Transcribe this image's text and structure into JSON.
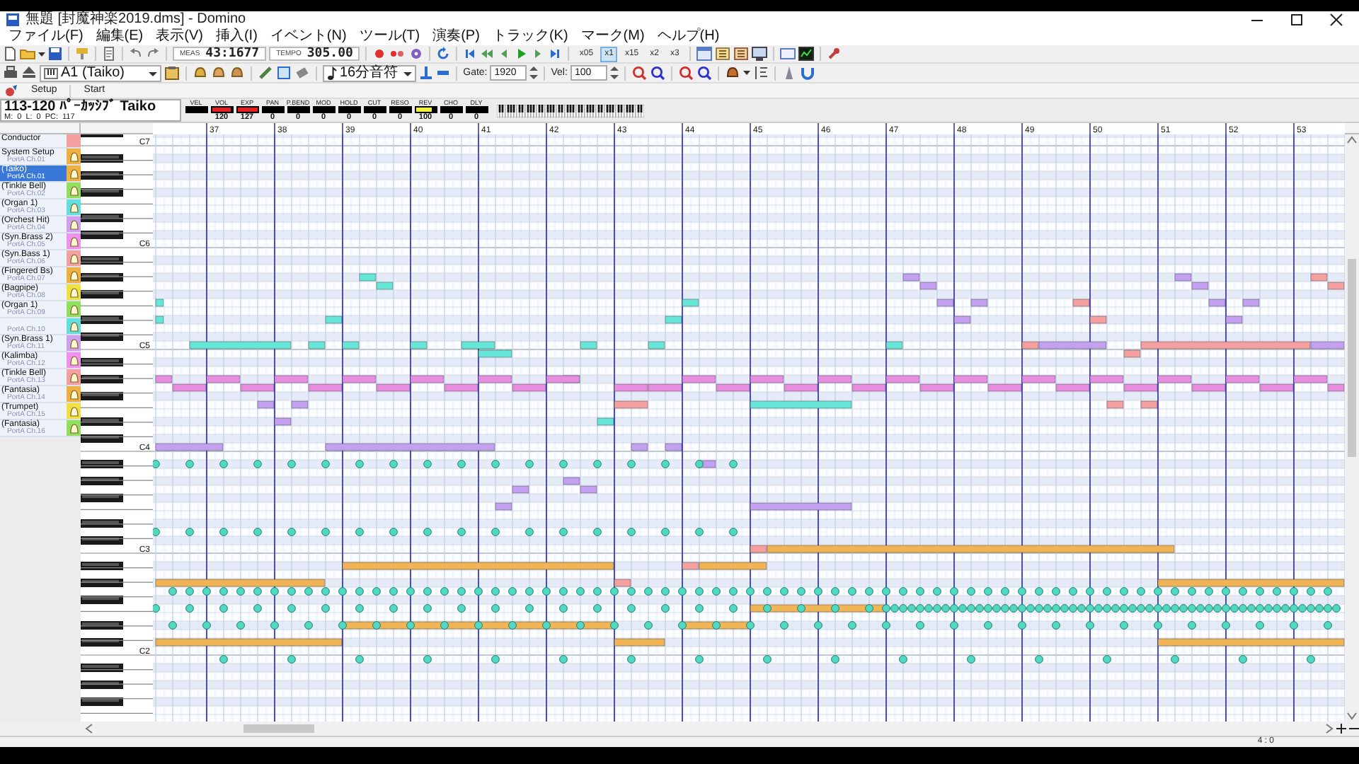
{
  "window": {
    "title": "無題 [封魔神楽2019.dms] - Domino"
  },
  "menu": [
    "ファイル(F)",
    "編集(E)",
    "表示(V)",
    "挿入(I)",
    "イベント(N)",
    "ツール(T)",
    "演奏(P)",
    "トラック(K)",
    "マーク(M)",
    "ヘルプ(H)"
  ],
  "toolbar": {
    "meas_label": "MEAS",
    "meas": "43:1677",
    "tempo_label": "TEMPO",
    "tempo": "305.00",
    "speeds": [
      {
        "label": "x05",
        "selected": false
      },
      {
        "label": "x1",
        "selected": true
      },
      {
        "label": "x15",
        "selected": false
      },
      {
        "label": "x2",
        "selected": false
      },
      {
        "label": "x3",
        "selected": false
      }
    ]
  },
  "toolbar2": {
    "instrument": "A1 (Taiko)",
    "note_length": "16分音符",
    "gate_label": "Gate:",
    "gate": "1920",
    "vel_label": "Vel:",
    "vel": "100"
  },
  "buttons": [
    "Setup",
    "Start"
  ],
  "info": {
    "program": "113-120 ﾊﾟｰｶｯｼﾌﾞ Taiko",
    "m_label": "M:",
    "m": "0",
    "l_label": "L:",
    "l": "0",
    "pc_label": "PC:",
    "pc": "117"
  },
  "mixer": [
    {
      "label": "VEL"
    },
    {
      "label": "VOL",
      "value": "120",
      "level": 0.94,
      "color": "#e02020"
    },
    {
      "label": "EXP",
      "value": "127",
      "level": 1,
      "color": "#e02020"
    },
    {
      "label": "PAN",
      "value": "0"
    },
    {
      "label": "P.BEND",
      "value": "0"
    },
    {
      "label": "MOD",
      "value": "0"
    },
    {
      "label": "HOLD",
      "value": "0"
    },
    {
      "label": "CUT",
      "value": "0"
    },
    {
      "label": "RESO",
      "value": "0"
    },
    {
      "label": "REV",
      "value": "100",
      "level": 0.79,
      "color": "#f0f040"
    },
    {
      "label": "CHO",
      "value": "0"
    },
    {
      "label": "DLY",
      "value": "0"
    }
  ],
  "tracks": [
    {
      "name": "Conductor",
      "color": "#f4a0a0",
      "selected": false
    },
    {
      "name": "System Setup",
      "port": "PortA  Ch.01",
      "color": "#f0b040",
      "selected": false
    },
    {
      "name": "(Taiko)",
      "port": "PortA  Ch.01",
      "color": "#f0b040",
      "selected": true
    },
    {
      "name": "(Tinkle Bell)",
      "port": "PortA  Ch.02",
      "color": "#90e060",
      "selected": false
    },
    {
      "name": "(Organ 1)",
      "port": "PortA  Ch.03",
      "color": "#60e0e0",
      "selected": false
    },
    {
      "name": "(Orchest Hit)",
      "port": "PortA  Ch.04",
      "color": "#d0a0f0",
      "selected": false
    },
    {
      "name": "(Syn.Brass 2)",
      "port": "PortA  Ch.05",
      "color": "#f090f0",
      "selected": false
    },
    {
      "name": "(Syn.Bass 1)",
      "port": "PortA  Ch.06",
      "color": "#f4a0a0",
      "selected": false
    },
    {
      "name": "(Fingered Bs)",
      "port": "PortA  Ch.07",
      "color": "#f0b040",
      "selected": false
    },
    {
      "name": "(Bagpipe)",
      "port": "PortA  Ch.08",
      "color": "#f0e040",
      "selected": false
    },
    {
      "name": "(Organ 1)",
      "port": "PortA  Ch.09",
      "color": "#90e060",
      "selected": false
    },
    {
      "port": "PortA  Ch.10",
      "color": "#60e0e0",
      "selected": false
    },
    {
      "name": "(Syn.Brass 1)",
      "port": "PortA  Ch.11",
      "color": "#d0a0f0",
      "selected": false
    },
    {
      "name": "(Kalimba)",
      "port": "PortA  Ch.12",
      "color": "#f090f0",
      "selected": false
    },
    {
      "name": "(Tinkle Bell)",
      "port": "PortA  Ch.13",
      "color": "#f4a0a0",
      "selected": false
    },
    {
      "name": "(Fantasia)",
      "port": "PortA  Ch.14",
      "color": "#f0b040",
      "selected": false
    },
    {
      "name": "(Trumpet)",
      "port": "PortA  Ch.15",
      "color": "#f0e040",
      "selected": false
    },
    {
      "name": "(Fantasia)",
      "port": "PortA  Ch.16",
      "color": "#90e060",
      "selected": false
    }
  ],
  "ruler": [
    "37",
    "38",
    "39",
    "40",
    "41",
    "42",
    "43",
    "44",
    "45",
    "46",
    "47",
    "48",
    "49",
    "50",
    "51",
    "52",
    "53"
  ],
  "keyboard": {
    "octave_labels": [
      "C7",
      "C6",
      "C5",
      "C4",
      "C3",
      "C2"
    ]
  },
  "status": {
    "position": "4 : 0"
  }
}
